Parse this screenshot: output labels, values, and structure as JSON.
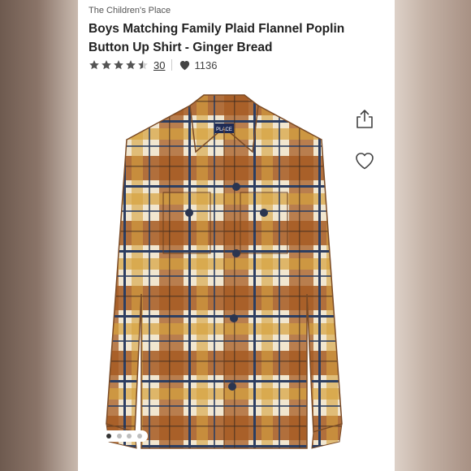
{
  "brand": "The Children's Place",
  "product": {
    "title": "Boys Matching Family Plaid Flannel Poplin Button Up Shirt - Ginger Bread",
    "rating": 4.5,
    "rating_max": 5,
    "review_count": "30",
    "likes": "1136",
    "image_label": "PLACE",
    "image_count": 4,
    "active_image": 1
  },
  "icons": {
    "share": "share-icon",
    "favorite": "heart-outline-icon",
    "likes": "heart-icon",
    "star": "star-icon"
  },
  "colors": {
    "star": "#555555",
    "plaid_rust": "#a65a22",
    "plaid_cream": "#f1e6cf",
    "plaid_navy": "#2c3e62",
    "plaid_mustard": "#d6a13e"
  }
}
